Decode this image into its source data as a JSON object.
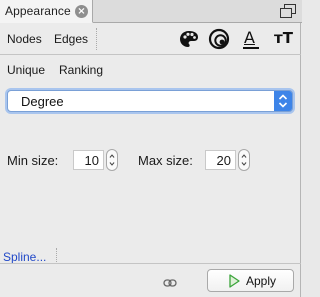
{
  "tab": {
    "title": "Appearance",
    "close_icon": "close-icon"
  },
  "toolbar": {
    "tabs": [
      "Nodes",
      "Edges"
    ],
    "icons": [
      "palette-icon",
      "size-icon",
      "label-color-icon",
      "label-size-icon"
    ],
    "label_color_glyph": "A",
    "label_size_glyph": "тT"
  },
  "subtabs": [
    "Unique",
    "Ranking"
  ],
  "attribute_select": {
    "value": "Degree"
  },
  "min_size": {
    "label": "Min size:",
    "value": "10"
  },
  "max_size": {
    "label": "Max size:",
    "value": "20"
  },
  "spline_link": "Spline...",
  "apply_button": {
    "label": "Apply"
  },
  "colors": {
    "accent": "#3d84e8",
    "link": "#2249c8",
    "apply_icon": "#3aa43a"
  }
}
